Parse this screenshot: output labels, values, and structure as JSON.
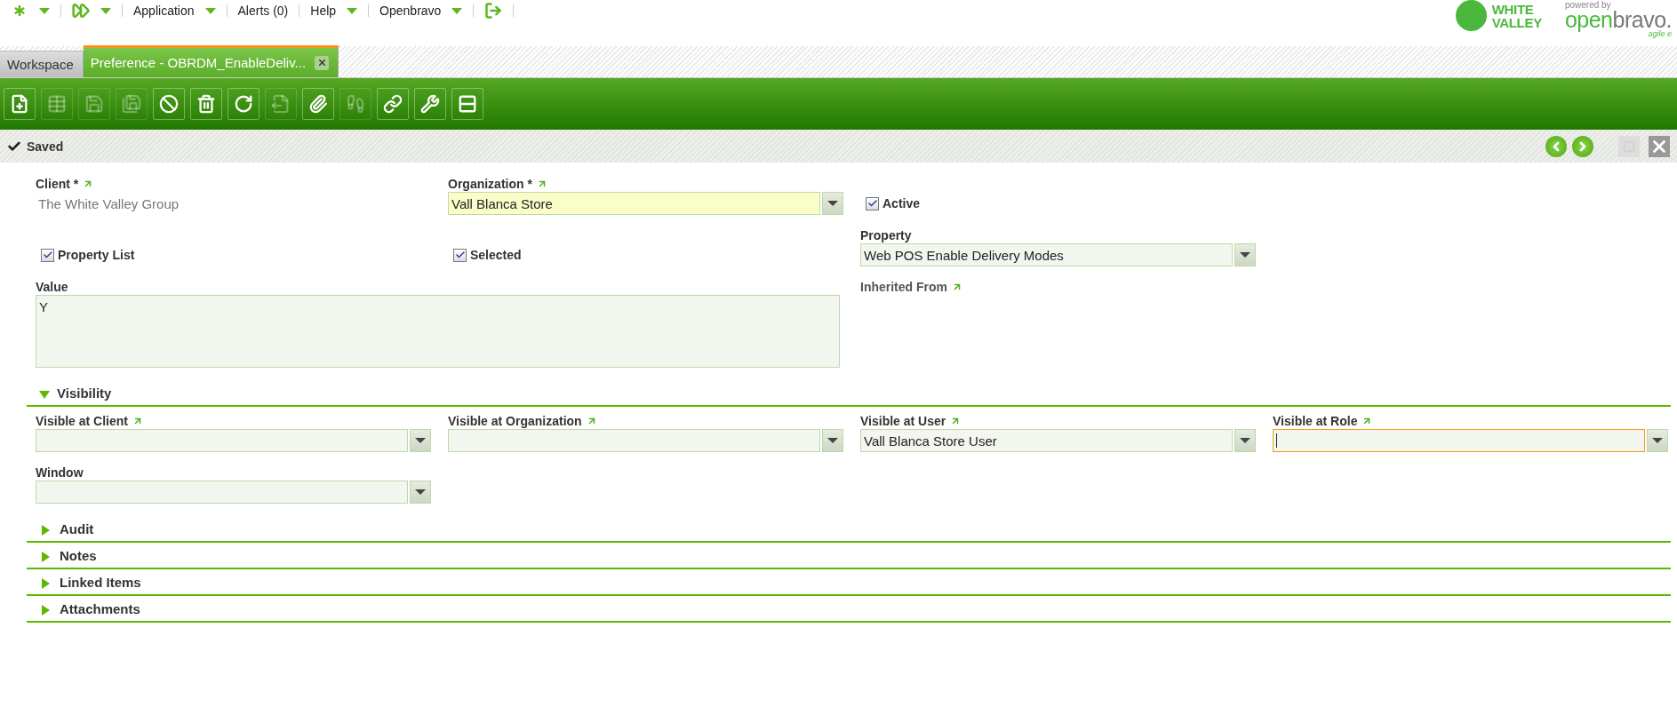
{
  "nav": [
    {
      "kind": "star",
      "dropdown": true
    },
    {
      "kind": "forward",
      "dropdown": true
    },
    {
      "kind": "text",
      "label": "Application",
      "dropdown": true
    },
    {
      "kind": "text",
      "label": "Alerts (0)",
      "dropdown": false
    },
    {
      "kind": "text",
      "label": "Help",
      "dropdown": true
    },
    {
      "kind": "text",
      "label": "Openbravo",
      "dropdown": true
    },
    {
      "kind": "logout",
      "dropdown": false
    }
  ],
  "logos": {
    "brand": [
      "WHITE",
      "VALLEY"
    ],
    "powered_by": "powered by",
    "product": [
      "open",
      "bravo."
    ],
    "tagline": "agile e"
  },
  "tabs": [
    {
      "label": "Workspace",
      "selected": false,
      "closable": false
    },
    {
      "label": "Preference - OBRDM_EnableDeliv...",
      "selected": true,
      "closable": true
    }
  ],
  "toolbar": [
    {
      "kind": "new",
      "disabled": false
    },
    {
      "kind": "grid",
      "disabled": true
    },
    {
      "kind": "save",
      "disabled": true
    },
    {
      "kind": "save-close",
      "disabled": true
    },
    {
      "kind": "undo",
      "disabled": false
    },
    {
      "kind": "delete",
      "disabled": false
    },
    {
      "kind": "refresh",
      "disabled": false
    },
    {
      "kind": "export",
      "disabled": true
    },
    {
      "kind": "attach",
      "disabled": false
    },
    {
      "kind": "footprints",
      "disabled": true
    },
    {
      "kind": "link",
      "disabled": false
    },
    {
      "kind": "tools",
      "disabled": false
    },
    {
      "kind": "split",
      "disabled": false
    }
  ],
  "status_bar": {
    "message": "Saved",
    "controls": [
      {
        "kind": "previous",
        "disabled": false
      },
      {
        "kind": "next",
        "disabled": false
      },
      {
        "kind": "maximize",
        "disabled": true
      },
      {
        "kind": "close",
        "disabled": false
      }
    ]
  },
  "form": {
    "rows": [
      [
        {
          "kind": "readonly",
          "label": "Client *",
          "link": true,
          "value": "The White Valley Group"
        },
        {
          "kind": "combo",
          "label": "Organization *",
          "link": true,
          "value": "Vall Blanca Store",
          "required": true,
          "focused": false
        },
        {
          "kind": "checkbox",
          "label": "Active",
          "checked": true
        }
      ],
      [
        {
          "kind": "checkbox",
          "label": "Property List",
          "checked": true
        },
        {
          "kind": "checkbox",
          "label": "Selected",
          "checked": true
        },
        {
          "kind": "combo",
          "label": "Property",
          "link": false,
          "value": "Web POS Enable Delivery Modes",
          "required": false,
          "focused": false
        }
      ],
      [
        {
          "kind": "textarea",
          "label": "Value",
          "value": "Y"
        },
        "",
        {
          "kind": "label",
          "label": "Inherited From",
          "link": true
        }
      ]
    ]
  },
  "sections": [
    {
      "title": "Visibility",
      "expanded": true,
      "rows": [
        [
          {
            "kind": "combo",
            "label": "Visible at Client",
            "link": true,
            "required": false,
            "focused": false
          },
          {
            "kind": "combo",
            "label": "Visible at Organization",
            "link": true,
            "required": false,
            "focused": false
          },
          {
            "kind": "combo",
            "label": "Visible at User",
            "link": true,
            "value": "Vall Blanca Store User",
            "required": false,
            "focused": false
          },
          {
            "kind": "combo",
            "label": "Visible at Role",
            "link": true,
            "required": false,
            "focused": true
          }
        ],
        [
          {
            "kind": "combo",
            "label": "Window",
            "link": false,
            "required": false,
            "focused": false
          }
        ]
      ]
    },
    {
      "title": "Audit",
      "expanded": false
    },
    {
      "title": "Notes",
      "expanded": false
    },
    {
      "title": "Linked Items",
      "expanded": false
    },
    {
      "title": "Attachments",
      "expanded": false
    }
  ]
}
